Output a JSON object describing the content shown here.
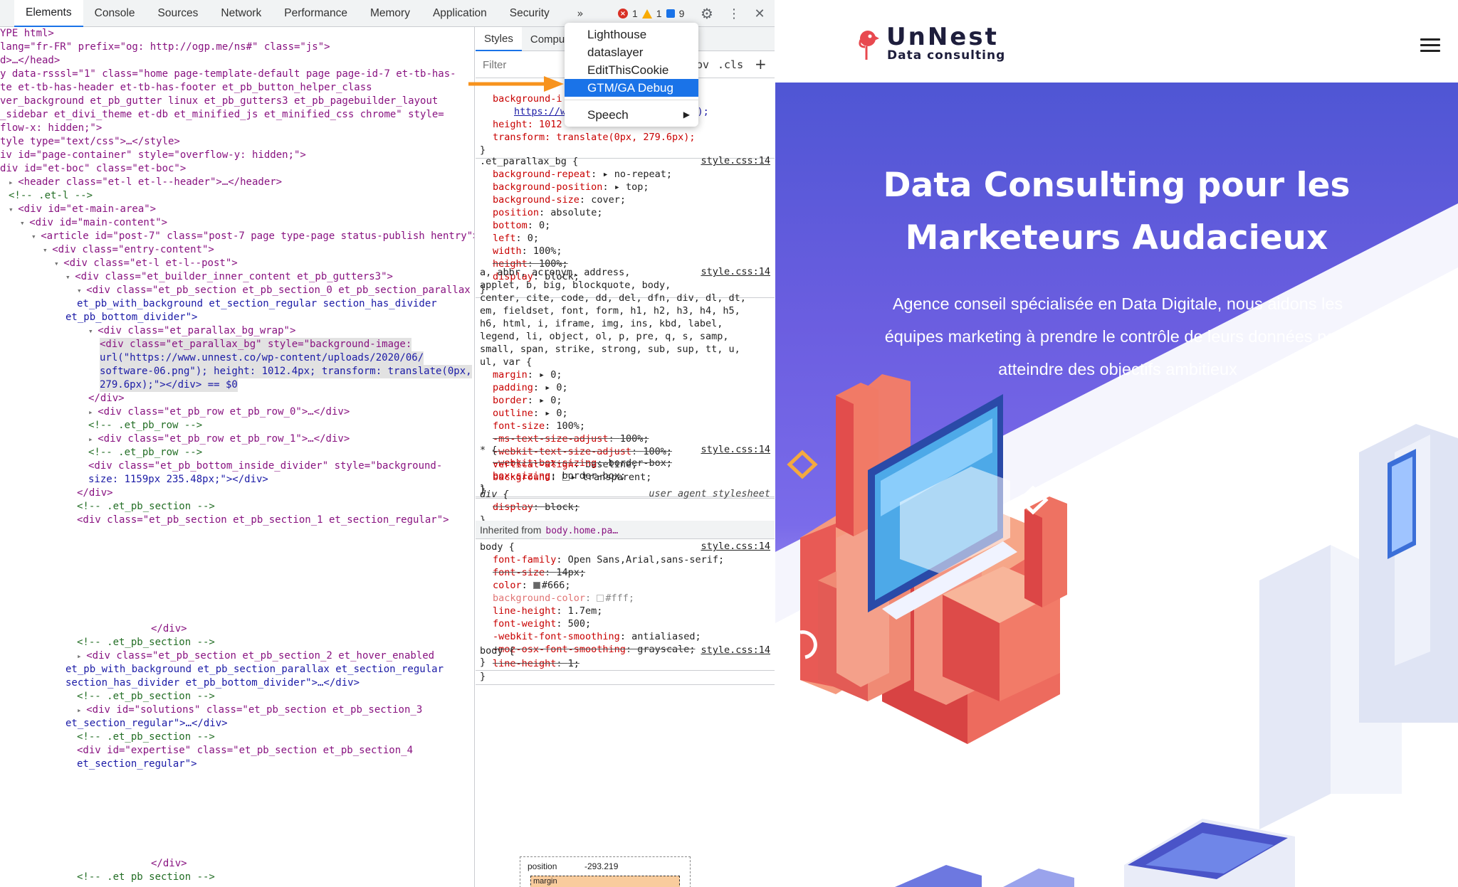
{
  "devtools": {
    "tabs": [
      "Elements",
      "Console",
      "Sources",
      "Network",
      "Performance",
      "Memory",
      "Application",
      "Security"
    ],
    "overflow_glyph": "»",
    "issues": {
      "errors": "1",
      "warnings": "1",
      "info": "9"
    },
    "overflow_menu": {
      "items": [
        "Lighthouse",
        "dataslayer",
        "EditThisCookie",
        "GTM/GA Debug"
      ],
      "highlighted": "GTM/GA Debug",
      "speech": "Speech"
    }
  },
  "elements": {
    "lines": [
      {
        "t": "YPE html>"
      },
      {
        "t": "lang=\"fr-FR\" prefix=\"og: http://ogp.me/ns#\" class=\"js\">"
      },
      {
        "t": "d>…</head>"
      },
      {
        "t": "y data-rsssl=\"1\" class=\"home page-template-default page page-id-7 et-tb-has-"
      },
      {
        "t": "te et-tb-has-header et-tb-has-footer et_pb_button_helper_class"
      },
      {
        "t": "ver_background et_pb_gutter linux et_pb_gutters3 et_pb_pagebuilder_layout"
      },
      {
        "t": "_sidebar et_divi_theme et-db et_minified_js et_minified_css chrome\" style="
      },
      {
        "t": "flow-x: hidden;\">"
      },
      {
        "t": "tyle type=\"text/css\">…</style>"
      },
      {
        "t": "iv id=\"page-container\" style=\"overflow-y: hidden;\">"
      },
      {
        "t": "div id=\"et-boc\" class=\"et-boc\">"
      },
      {
        "t": "<header class=\"et-l et-l--header\">…</header>"
      },
      {
        "t": "<!-- .et-l -->"
      },
      {
        "t": "<div id=\"et-main-area\">"
      },
      {
        "t": "<div id=\"main-content\">"
      },
      {
        "t": "<article id=\"post-7\" class=\"post-7 page type-page status-publish hentry\">"
      },
      {
        "t": "<div class=\"entry-content\">"
      },
      {
        "t": "<div class=\"et-l et-l--post\">"
      },
      {
        "t": "<div class=\"et_builder_inner_content et_pb_gutters3\">"
      },
      {
        "t": "<div class=\"et_pb_section et_pb_section_0 et_pb_section_parallax"
      },
      {
        "t": "et_pb_with_background et_section_regular section_has_divider"
      },
      {
        "t": "et_pb_bottom_divider\">"
      },
      {
        "t": "<div class=\"et_parallax_bg_wrap\">"
      },
      {
        "t": "<div class=\"et_parallax_bg\" style=\"background-image:"
      },
      {
        "t": "url(\"https://www.unnest.co/wp-content/uploads/2020/06/"
      },
      {
        "t": "software-06.png\"); height: 1012.4px; transform: translate(0px,"
      },
      {
        "t": "279.6px);\"></div> == $0"
      },
      {
        "t": "</div>"
      },
      {
        "t": "<div class=\"et_pb_row et_pb_row_0\">…</div>"
      },
      {
        "t": "<!-- .et_pb_row -->"
      },
      {
        "t": "<div class=\"et_pb_row et_pb_row_1\">…</div>"
      },
      {
        "t": "<!-- .et_pb_row -->"
      },
      {
        "t": "<div class=\"et_pb_bottom_inside_divider\" style=\"background-"
      },
      {
        "t": "size: 1159px 235.48px;\"></div>"
      },
      {
        "t": "</div>"
      },
      {
        "t": "<!-- .et_pb_section -->"
      },
      {
        "t": "<div class=\"et_pb_section et_pb_section_1 et_section_regular\">"
      },
      {
        "t": "</div>"
      },
      {
        "t": "<!-- .et_pb_section -->"
      },
      {
        "t": "<div class=\"et_pb_section et_pb_section_2 et_hover_enabled"
      },
      {
        "t": "et_pb_with_background et_pb_section_parallax et_section_regular"
      },
      {
        "t": "section_has_divider et_pb_bottom_divider\">…</div>"
      },
      {
        "t": "<!-- .et_pb_section -->"
      },
      {
        "t": "<div id=\"solutions\" class=\"et_pb_section et_pb_section_3"
      },
      {
        "t": "et_section_regular\">…</div>"
      },
      {
        "t": "<!-- .et_pb_section -->"
      },
      {
        "t": "<div id=\"expertise\" class=\"et_pb_section et_pb_section_4"
      },
      {
        "t": "et_section_regular\">"
      },
      {
        "t": "</div>"
      },
      {
        "t": "<!-- .et pb section -->"
      }
    ]
  },
  "styles": {
    "tabs": [
      "Styles",
      "Compu"
    ],
    "filter_placeholder": "Filter",
    "hov": "ov",
    "cls": ".cls",
    "plus": "+",
    "element_rule": {
      "lines": [
        "background-i",
        "https://w",
        "height: 1012",
        "transform: translate(0px, 279.6px);"
      ],
      "url_tail": "nt…);"
    },
    "rule_parallax": {
      "selector": ".et_parallax_bg {",
      "source": "style.css:14",
      "props": [
        {
          "n": "background-repeat",
          "v": "▸ no-repeat;"
        },
        {
          "n": "background-position",
          "v": "▸ top;"
        },
        {
          "n": "background-size",
          "v": "cover;"
        },
        {
          "n": "position",
          "v": "absolute;"
        },
        {
          "n": "bottom",
          "v": "0;"
        },
        {
          "n": "left",
          "v": "0;"
        },
        {
          "n": "width",
          "v": "100%;"
        },
        {
          "n": "height",
          "v": "100%;",
          "struck": true
        },
        {
          "n": "display",
          "v": "block;"
        }
      ]
    },
    "rule_reset": {
      "selector_lines": [
        "a, abbr, acronym, address,",
        "applet, b, big, blockquote, body,",
        "center, cite, code, dd, del, dfn, div, dl, dt,",
        "em, fieldset, font, form, h1, h2, h3, h4, h5,",
        "h6, html, i, iframe, img, ins, kbd, label,",
        "legend, li, object, ol, p, pre, q, s, samp,",
        "small, span, strike, strong, sub, sup, tt, u,",
        "ul, var {"
      ],
      "source": "style.css:14",
      "props": [
        {
          "n": "margin",
          "v": "▸ 0;"
        },
        {
          "n": "padding",
          "v": "▸ 0;"
        },
        {
          "n": "border",
          "v": "▸ 0;"
        },
        {
          "n": "outline",
          "v": "▸ 0;"
        },
        {
          "n": "font-size",
          "v": "100%;"
        },
        {
          "n": "-ms-text-size-adjust",
          "v": "100%;",
          "struck": true
        },
        {
          "n": "-webkit-text-size-adjust",
          "v": "100%;",
          "struck": true
        },
        {
          "n": "vertical-align",
          "v": "baseline;"
        },
        {
          "n": "background",
          "v": "▸ transparent;",
          "swatch": "transparent"
        }
      ]
    },
    "rule_star": {
      "selector": "* {",
      "source": "style.css:14",
      "props": [
        {
          "n": "-webkit-box-sizing",
          "v": "border-box;",
          "struck": true
        },
        {
          "n": "box-sizing",
          "v": "border-box;"
        }
      ]
    },
    "rule_ua": {
      "selector": "div {",
      "source": "user agent stylesheet",
      "props": [
        {
          "n": "display",
          "v": "block;",
          "struck": true
        }
      ]
    },
    "inherited_label": "Inherited from",
    "inherited_from": "body.home.pa…",
    "rule_body": {
      "selector": "body {",
      "source": "style.css:14",
      "props": [
        {
          "n": "font-family",
          "v": "Open Sans,Arial,sans-serif;"
        },
        {
          "n": "font-size",
          "v": "14px;",
          "struck": true
        },
        {
          "n": "color",
          "v": "#666;",
          "swatch": "#666666"
        },
        {
          "n": "background-color",
          "v": "#fff;",
          "swatch": "#ffffff",
          "dim": true
        },
        {
          "n": "line-height",
          "v": "1.7em;"
        },
        {
          "n": "font-weight",
          "v": "500;"
        },
        {
          "n": "-webkit-font-smoothing",
          "v": "antialiased;"
        },
        {
          "n": "-moz-osx-font-smoothing",
          "v": "grayscale;",
          "struck": true
        }
      ]
    },
    "rule_body2": {
      "selector": "body {",
      "source": "style.css:14",
      "props": [
        {
          "n": "line-height",
          "v": "1;",
          "struck": true
        }
      ]
    },
    "box_model": {
      "label": "position",
      "value": "-293.219",
      "margin_label": "margin"
    }
  },
  "site": {
    "brand_name": "UnNest",
    "brand_tagline": "Data consulting",
    "hero_title_1": "Data Consulting pour les",
    "hero_title_2": "Marketeurs Audacieux",
    "hero_sub": "Agence conseil spécialisée en Data Digitale, nous aidons les équipes marketing à prendre le contrôle de leurs données pour atteindre des objectifs ambitieux",
    "colors": {
      "brand_red": "#e8494f",
      "hero_top": "#4f56d4",
      "dark": "#1e1e3c"
    }
  }
}
